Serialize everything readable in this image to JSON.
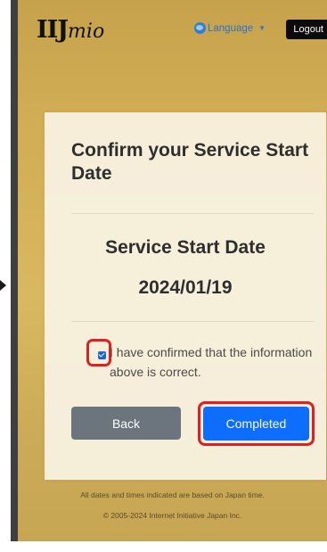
{
  "header": {
    "logo_text": "IIJ",
    "logo_suffix": "mio",
    "language_label": "Language",
    "logout_label": "Logout"
  },
  "card": {
    "title": "Confirm your Service Start Date",
    "date_label": "Service Start Date",
    "date_value": "2024/01/19",
    "checkbox_checked": true,
    "confirm_text": "I have confirmed that the information above is correct.",
    "back_label": "Back",
    "completed_label": "Completed"
  },
  "footer": {
    "note": "All dates and times indicated are based on Japan time.",
    "copyright": "© 2005-2024 Internet Initiative Japan Inc."
  },
  "colors": {
    "primary_button": "#0d6efd",
    "secondary_button": "#6c757d",
    "highlight": "#e02020",
    "background": "#d1ad55"
  }
}
